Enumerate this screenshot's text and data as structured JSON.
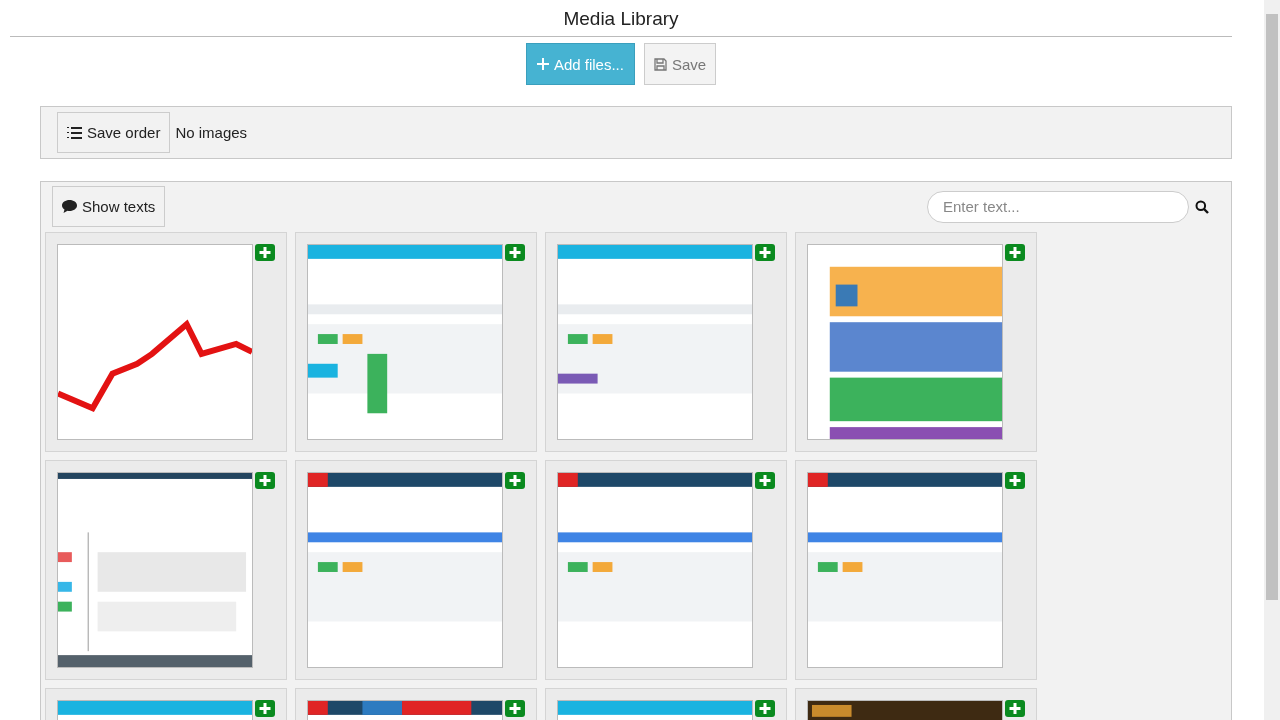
{
  "title": "Media Library",
  "toolbar": {
    "add_button": "Add files...",
    "save_button": "Save",
    "save_disabled": true
  },
  "order_panel": {
    "save_order_button": "Save order",
    "status": "No images"
  },
  "gallery": {
    "show_texts_button": "Show texts",
    "search": {
      "placeholder": "Enter text..."
    }
  }
}
